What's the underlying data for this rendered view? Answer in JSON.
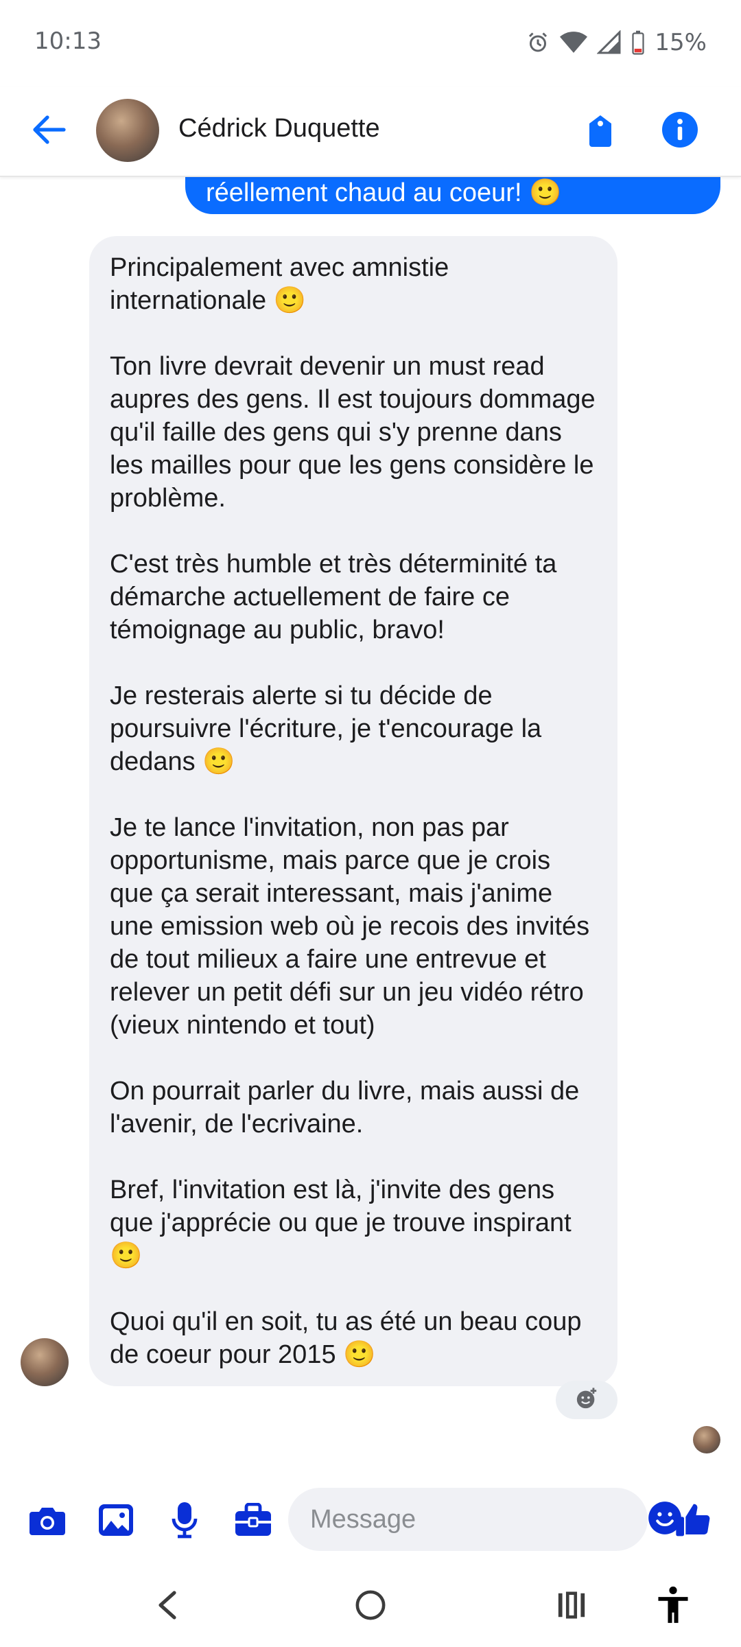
{
  "status_bar": {
    "time": "10:13",
    "battery": "15%"
  },
  "header": {
    "contact_name": "Cédrick Duquette"
  },
  "messages": {
    "sent_partial": "réellement chaud au coeur! 🙂",
    "received": [
      "Principalement avec amnistie internationale 🙂",
      "Ton livre devrait devenir un must read aupres des gens. Il est toujours dommage qu'il faille des gens qui s'y prenne dans les mailles pour que les gens considère le problème.",
      "C'est très humble et très déterminité ta démarche actuellement de faire ce témoignage au public, bravo!",
      "Je resterais alerte si tu décide de poursuivre l'écriture, je t'encourage la dedans 🙂",
      "Je te lance l'invitation, non pas par opportunisme, mais parce que je crois que ça serait interessant, mais j'anime une emission web où je recois des invités de tout milieux a faire une entrevue et relever un petit défi sur un jeu vidéo rétro (vieux nintendo et tout)",
      "On pourrait parler du livre, mais aussi de l'avenir, de l'ecrivaine.",
      "Bref, l'invitation est là, j'invite des gens que j'apprécie ou que je trouve inspirant 🙂",
      "Quoi qu'il en soit, tu as été un beau coup de coeur pour 2015 🙂"
    ]
  },
  "composer": {
    "placeholder": "Message"
  },
  "colors": {
    "accent": "#0a6cff",
    "icon_blue": "#0a2fd6",
    "received_bubble": "#f0f1f5"
  },
  "icons": [
    "back-arrow-icon",
    "tag-icon",
    "info-icon",
    "camera-icon",
    "image-icon",
    "microphone-icon",
    "briefcase-icon",
    "emoji-icon",
    "thumbs-up-icon",
    "add-reaction-icon"
  ]
}
